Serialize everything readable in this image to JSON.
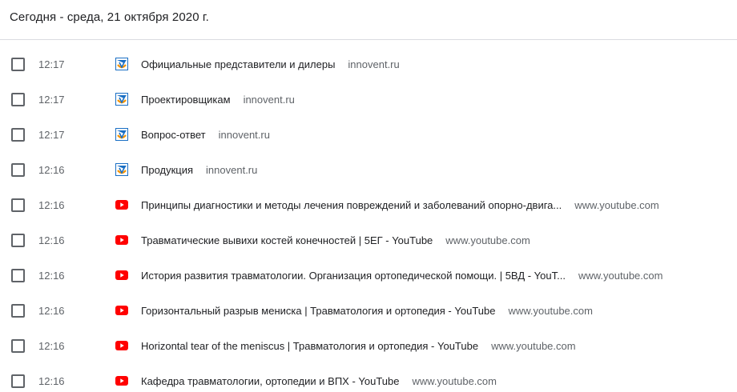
{
  "header": {
    "day_title": "Сегодня - среда, 21 октября 2020 г."
  },
  "colors": {
    "youtube_red": "#ff0000",
    "innovent_blue": "#1a6fc4",
    "innovent_orange": "#f39200"
  },
  "entries": [
    {
      "time": "12:17",
      "icon": "innovent-favicon-icon",
      "title": "Официальные представители и дилеры",
      "domain": "innovent.ru"
    },
    {
      "time": "12:17",
      "icon": "innovent-favicon-icon",
      "title": "Проектировщикам",
      "domain": "innovent.ru"
    },
    {
      "time": "12:17",
      "icon": "innovent-favicon-icon",
      "title": "Вопрос-ответ",
      "domain": "innovent.ru"
    },
    {
      "time": "12:16",
      "icon": "innovent-favicon-icon",
      "title": "Продукция",
      "domain": "innovent.ru"
    },
    {
      "time": "12:16",
      "icon": "youtube-favicon-icon",
      "title": "Принципы диагностики и методы лечения повреждений и заболеваний опорно-двига...",
      "domain": "www.youtube.com"
    },
    {
      "time": "12:16",
      "icon": "youtube-favicon-icon",
      "title": "Травматические вывихи костей конечностей | 5ЕГ - YouTube",
      "domain": "www.youtube.com"
    },
    {
      "time": "12:16",
      "icon": "youtube-favicon-icon",
      "title": "История развития травматологии. Организация ортопедической помощи. | 5ВД - YouT...",
      "domain": "www.youtube.com"
    },
    {
      "time": "12:16",
      "icon": "youtube-favicon-icon",
      "title": "Горизонтальный разрыв мениска | Травматология и ортопедия - YouTube",
      "domain": "www.youtube.com"
    },
    {
      "time": "12:16",
      "icon": "youtube-favicon-icon",
      "title": "Horizontal tear of the meniscus | Травматология и ортопедия - YouTube",
      "domain": "www.youtube.com"
    },
    {
      "time": "12:16",
      "icon": "youtube-favicon-icon",
      "title": "Кафедра травматологии, ортопедии и ВПХ - YouTube",
      "domain": "www.youtube.com"
    }
  ]
}
